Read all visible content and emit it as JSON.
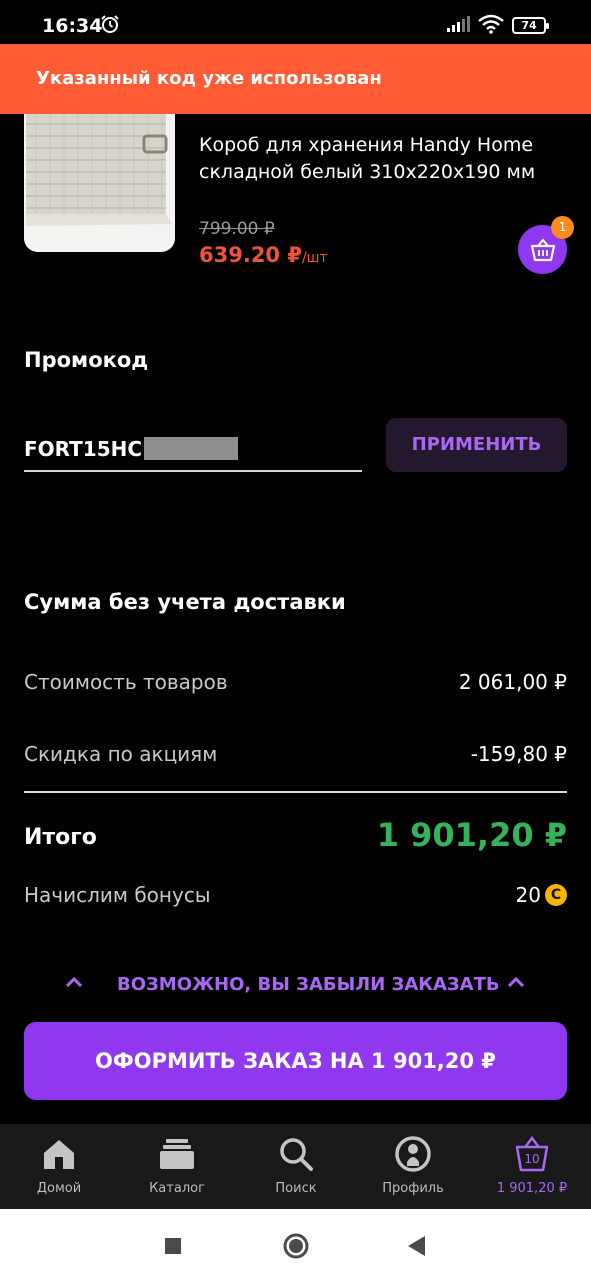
{
  "status_bar": {
    "time": "16:34",
    "battery": "74"
  },
  "toast": {
    "message": "Указанный код уже использован"
  },
  "product": {
    "name": "Короб для хранения Handy Home складной белый 310x220x190 мм",
    "old_price": "799.00 ₽",
    "new_price": "639.20 ₽",
    "unit": "/шт",
    "cart_qty": "1"
  },
  "promo": {
    "title": "Промокод",
    "code_visible": "FORT15HC",
    "apply_label": "ПРИМЕНИТЬ"
  },
  "summary": {
    "title": "Сумма без учета доставки",
    "goods_label": "Стоимость товаров",
    "goods_value": "2 061,00 ₽",
    "discount_label": "Скидка по акциям",
    "discount_value": "-159,80 ₽",
    "total_label": "Итого",
    "total_value": "1 901,20 ₽",
    "bonus_label": "Начислим бонусы",
    "bonus_value": "20"
  },
  "forgot": {
    "label": "ВОЗМОЖНО, ВЫ ЗАБЫЛИ ЗАКАЗАТЬ"
  },
  "checkout": {
    "label": "ОФОРМИТЬ ЗАКАЗ НА 1 901,20 ₽"
  },
  "bottom_nav": {
    "home": "Домой",
    "catalog": "Каталог",
    "search": "Поиск",
    "profile": "Профиль",
    "cart": "1 901,20 ₽",
    "cart_count": "10"
  },
  "colors": {
    "toast": "#ff5c35",
    "accent": "#9038f0",
    "price_red": "#f0533a",
    "total_green": "#35b35a"
  }
}
